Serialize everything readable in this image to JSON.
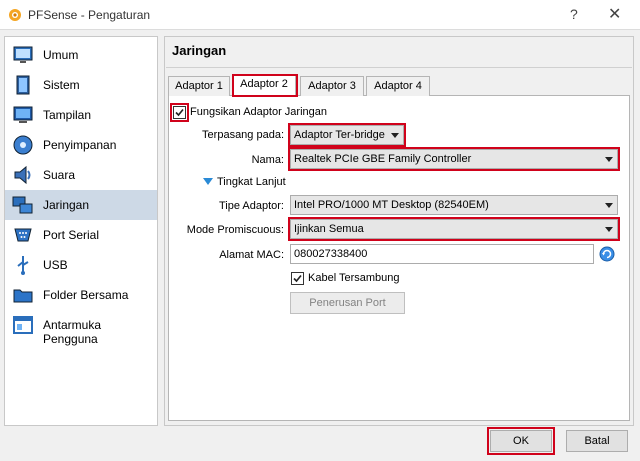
{
  "window": {
    "title": "PFSense - Pengaturan",
    "help": "?",
    "close": "✕"
  },
  "sidebar": {
    "items": [
      {
        "label": "Umum",
        "icon": "monitor-icon"
      },
      {
        "label": "Sistem",
        "icon": "chip-icon"
      },
      {
        "label": "Tampilan",
        "icon": "display-icon"
      },
      {
        "label": "Penyimpanan",
        "icon": "disk-icon"
      },
      {
        "label": "Suara",
        "icon": "speaker-icon"
      },
      {
        "label": "Jaringan",
        "icon": "network-icon",
        "selected": true
      },
      {
        "label": "Port Serial",
        "icon": "serial-port-icon"
      },
      {
        "label": "USB",
        "icon": "usb-icon"
      },
      {
        "label": "Folder Bersama",
        "icon": "folder-icon"
      },
      {
        "label": "Antarmuka Pengguna",
        "icon": "ui-icon"
      }
    ]
  },
  "main": {
    "title": "Jaringan",
    "tabs": [
      {
        "label": "Adaptor 1"
      },
      {
        "label": "Adaptor 2",
        "active": true
      },
      {
        "label": "Adaptor 3"
      },
      {
        "label": "Adaptor 4"
      }
    ],
    "enable_adapter": {
      "label": "Fungsikan Adaptor Jaringan",
      "checked": true
    },
    "attached_to": {
      "label": "Terpasang pada:",
      "value": "Adaptor Ter-bridge"
    },
    "name": {
      "label": "Nama:",
      "value": "Realtek PCIe GBE Family Controller"
    },
    "advanced": {
      "label": "Tingkat Lanjut"
    },
    "adapter_type": {
      "label": "Tipe Adaptor:",
      "value": "Intel PRO/1000 MT Desktop (82540EM)"
    },
    "promiscuous": {
      "label": "Mode Promiscuous:",
      "value": "Ijinkan Semua"
    },
    "mac": {
      "label": "Alamat MAC:",
      "value": "080027338400"
    },
    "cable": {
      "label": "Kabel Tersambung",
      "checked": true
    },
    "port_forward": {
      "label": "Penerusan Port"
    }
  },
  "footer": {
    "ok": "OK",
    "cancel": "Batal"
  },
  "colors": {
    "highlight": "#d0021b",
    "selected_bg": "#cdd9e6"
  }
}
